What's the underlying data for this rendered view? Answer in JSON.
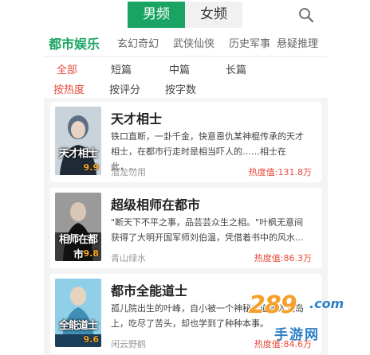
{
  "gender_tabs": [
    {
      "label": "男频",
      "active": true
    },
    {
      "label": "女频",
      "active": false
    }
  ],
  "search": {
    "icon": "search-icon"
  },
  "categories": [
    {
      "label": "都市娱乐",
      "active": true
    },
    {
      "label": "玄幻奇幻",
      "active": false
    },
    {
      "label": "武侠仙侠",
      "active": false
    },
    {
      "label": "历史军事",
      "active": false
    },
    {
      "label": "悬疑推理",
      "active": false
    }
  ],
  "length_filters": [
    {
      "label": "全部",
      "active": true
    },
    {
      "label": "短篇",
      "active": false
    },
    {
      "label": "中篇",
      "active": false
    },
    {
      "label": "长篇",
      "active": false
    }
  ],
  "sort_filters": [
    {
      "label": "按热度",
      "active": true
    },
    {
      "label": "按评分",
      "active": false
    },
    {
      "label": "按字数",
      "active": false
    }
  ],
  "books": [
    {
      "title": "天才相士",
      "cover_title": "天才相士",
      "score": "9.9",
      "desc": "铁口直断，一卦千金，快意恩仇某神棍传承的天才相士，在都市行走时是相当吓人的……相士在此，...",
      "author": "潜龙勿用",
      "heat": "热度值:131.8万",
      "cover_colors": [
        "#c9d3dc",
        "#5d6f82",
        "#1f2a36"
      ]
    },
    {
      "title": "超级相师在都市",
      "cover_title": "相师在都市",
      "score": "9.8",
      "desc": "\"断天下不平之事，品芸芸众生之相。\"叶枫无意间获得了大明开国军师刘伯温，凭借着书中的风水...",
      "author": "青山绿水",
      "heat": "热度值:86.3万",
      "cover_colors": [
        "#9a9a9a",
        "#3c3c3c",
        "#111111"
      ]
    },
    {
      "title": "都市全能道士",
      "cover_title": "全能道士",
      "score": "9.6",
      "desc": "孤儿院出生的叶峰，自小被一个神秘老道带入荒岛上，吃尽了苦头，却也学到了种种本事。",
      "author": "闲云野鹤",
      "heat": "热度值:84.6万",
      "cover_colors": [
        "#8fd0e8",
        "#3f8fb5",
        "#1b3f5a"
      ]
    }
  ],
  "watermark": {
    "number": "289",
    "domain": ".com",
    "text": "手游网"
  }
}
